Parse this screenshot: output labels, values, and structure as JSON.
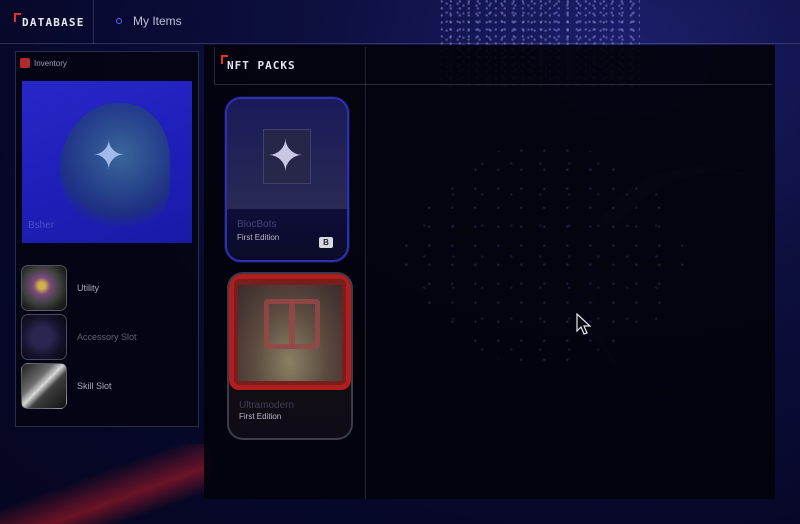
{
  "brand": {
    "title": "DATABASE"
  },
  "nav": {
    "my_items_label": "My Items"
  },
  "inventory": {
    "title": "Inventory",
    "feature_label": "Bsher",
    "slots": [
      {
        "label": "Utility"
      },
      {
        "label": "Accessory Slot"
      },
      {
        "label": "Skill Slot"
      }
    ]
  },
  "packs": {
    "title": "NFT PACKS",
    "cards": [
      {
        "title": "BlocBots",
        "edition": "First Edition",
        "badge": "B"
      },
      {
        "title": "Ultramodern",
        "edition": "First Edition"
      }
    ]
  },
  "colors": {
    "accent_red": "#e0312f",
    "accent_blue": "#2e2fb8",
    "background": "#07082a"
  }
}
